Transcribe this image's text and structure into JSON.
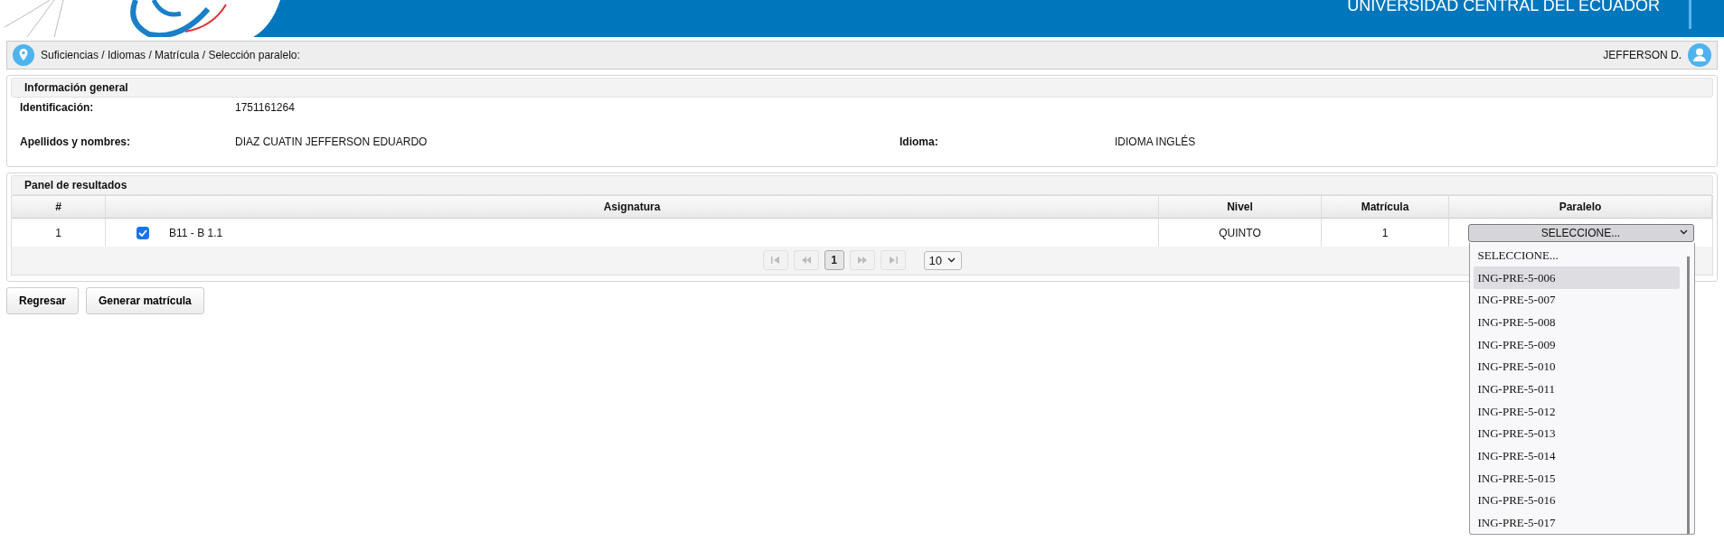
{
  "header": {
    "title": "UNIVERSIDAD CENTRAL DEL ECUADOR"
  },
  "breadcrumb": {
    "path": "Suficiencias / Idiomas / Matrícula / Selección paralelo:",
    "user": "JEFFERSON D."
  },
  "info": {
    "title": "Información general",
    "rows": [
      [
        {
          "label": "Identificación:",
          "value": "1751161264"
        }
      ],
      [
        {
          "label": "Apellidos y nombres:",
          "value": "DIAZ CUATIN JEFFERSON EDUARDO"
        },
        {
          "label": "Idioma:",
          "value": "IDIOMA INGLÉS"
        }
      ]
    ]
  },
  "results": {
    "title": "Panel de resultados",
    "columns": [
      "#",
      "Asignatura",
      "Nivel",
      "Matrícula",
      "Paralelo"
    ],
    "rows": [
      {
        "number": "1",
        "checked": true,
        "subject": "B11 - B 1.1",
        "level_name": "QUINTO",
        "enrollment": "1",
        "paralelo": {
          "value": "SELECCIONE...",
          "expanded": true,
          "options": [
            {
              "label": "SELECCIONE...",
              "highlighted": false
            },
            {
              "label": "ING-PRE-5-006",
              "highlighted": true
            },
            {
              "label": "ING-PRE-5-007",
              "highlighted": false
            },
            {
              "label": "ING-PRE-5-008",
              "highlighted": false
            },
            {
              "label": "ING-PRE-5-009",
              "highlighted": false
            },
            {
              "label": "ING-PRE-5-010",
              "highlighted": false
            },
            {
              "label": "ING-PRE-5-011",
              "highlighted": false
            },
            {
              "label": "ING-PRE-5-012",
              "highlighted": false
            },
            {
              "label": "ING-PRE-5-013",
              "highlighted": false
            },
            {
              "label": "ING-PRE-5-014",
              "highlighted": false
            },
            {
              "label": "ING-PRE-5-015",
              "highlighted": false
            },
            {
              "label": "ING-PRE-5-016",
              "highlighted": false
            },
            {
              "label": "ING-PRE-5-017",
              "highlighted": false
            }
          ]
        }
      }
    ],
    "pager": {
      "pages": [
        {
          "label": "1",
          "selected": true
        }
      ],
      "page_size": "10"
    }
  },
  "buttons": [
    "Regresar",
    "Generar matrícula"
  ]
}
